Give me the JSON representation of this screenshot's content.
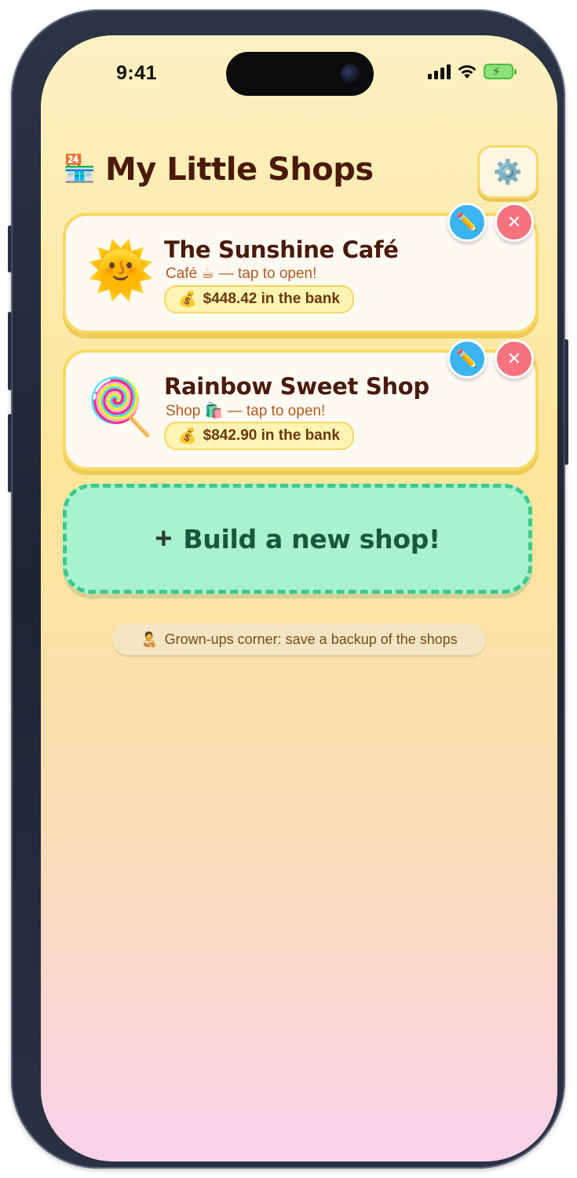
{
  "status_bar": {
    "time": "9:41"
  },
  "header": {
    "icon": "convenience-store-icon",
    "icon_glyph": "🏪",
    "title": "My Little Shops",
    "settings_glyph": "⚙️"
  },
  "shops": [
    {
      "emoji": "🌞",
      "name": "The Sunshine Café",
      "subtitle": "Café ☕ — tap to open!",
      "bank_icon": "💰",
      "bank": "$448.42 in the bank"
    },
    {
      "emoji": "🍭",
      "name": "Rainbow Sweet Shop",
      "subtitle": "Shop 🛍️ — tap to open!",
      "bank_icon": "💰",
      "bank": "$842.90 in the bank"
    }
  ],
  "actions": {
    "edit_glyph": "✏️",
    "delete_glyph": "✕"
  },
  "new_shop": {
    "plus": "+",
    "label": "Build a new shop!"
  },
  "backup": {
    "icon_glyph": "🧑‍🍼",
    "label": "Grown-ups corner: save a backup of the shops"
  },
  "colors": {
    "title": "#4a1a0b",
    "card_border": "#f8d862",
    "new_shop_bg": "#a8f2cf",
    "new_shop_border": "#3dc98a",
    "edit": "#3bb4f0",
    "delete": "#f4737f"
  }
}
